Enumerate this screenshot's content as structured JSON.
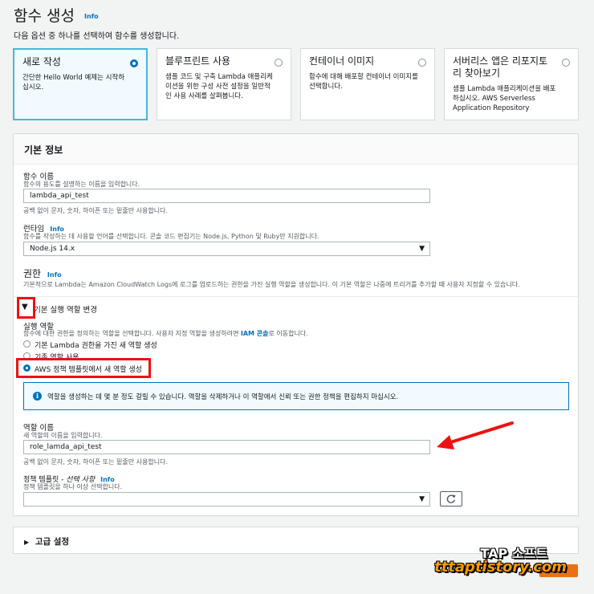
{
  "header": {
    "title": "함수 생성",
    "info": "Info",
    "subtitle": "다음 옵션 중 하나를 선택하여 함수를 생성합니다."
  },
  "options": [
    {
      "title": "새로 작성",
      "desc": "간단한 Hello World 예제는 시작하십시오.",
      "selected": true
    },
    {
      "title": "블루프린트 사용",
      "desc": "샘플 코드 및 구축 Lambda 애플리케이션을 위한 구성 사전 설정을 일반적인 사용 사례를 살펴봅니다.",
      "selected": false
    },
    {
      "title": "컨테이너 이미지",
      "desc": "함수에 대해 배포할 컨테이너 이미지를 선택합니다.",
      "selected": false
    },
    {
      "title": "서버리스 앱은 리포지토리 찾아보기",
      "desc": "샘플 Lambda 애플리케이션을 배포하십시오. AWS Serverless Application Repository",
      "selected": false
    }
  ],
  "basic": {
    "heading": "기본 정보",
    "fn_name_label": "함수 이름",
    "fn_name_desc": "함수의 용도를 설명하는 이름을 입력합니다.",
    "fn_name_value": "lambda_api_test",
    "fn_name_hint": "공백 없이 문자, 숫자, 하이픈 또는 밑줄만 사용합니다.",
    "runtime_label": "런타임",
    "runtime_info": "Info",
    "runtime_desc": "함수를 작성하는 데 사용할 언어를 선택합니다. 콘솔 코드 편집기는 Node.js, Python 및 Ruby만 지원합니다.",
    "runtime_value": "Node.js 14.x",
    "perm_label": "권한",
    "perm_info": "Info",
    "perm_desc": "기본적으로 Lambda는 Amazon CloudWatch Logs에 로그를 업로드하는 권한을 가진 실행 역할을 생성합니다. 이 기본 역할은 나중에 트리거를 추가할 때 사용자 지정할 수 있습니다."
  },
  "role": {
    "toggle_label": "기본 실행 역할 변경",
    "exec_label": "실행 역할",
    "exec_desc": "함수에 대한 권한을 정의하는 역할을 선택합니다. 사용자 지정 역할을 생성하려면",
    "iam_link": "IAM 콘솔",
    "exec_desc_tail": "로 이동합니다.",
    "opt1": "기본 Lambda 권한을 가진 새 역할 생성",
    "opt2": "기존 역할 사용",
    "opt3": "AWS 정책 템플릿에서 새 역할 생성",
    "alert": "역할을 생성하는 데 몇 분 정도 걸릴 수 있습니다. 역할을 삭제하거나 이 역할에서 신뢰 또는 권한 정책을 편집하지 마십시오.",
    "role_name_label": "역할 이름",
    "role_name_desc": "새 역할의 이름을 입력합니다.",
    "role_name_value": "role_lamda_api_test",
    "role_name_hint": "공백 없이 문자, 숫자, 하이픈 또는 밑줄만 사용합니다.",
    "policy_label": "정책 템플릿 - ",
    "policy_optional": "선택 사항",
    "policy_info": "Info",
    "policy_desc": "정책 템플릿을 하나 이상 선택합니다."
  },
  "advanced": {
    "label": "고급 설정"
  },
  "watermark": {
    "line1": "TAP 소프트",
    "line2": "tttaptistory.com"
  },
  "colors": {
    "accent": "#0073bb",
    "highlight": "#e11111",
    "selected_border": "#44b9d6"
  }
}
